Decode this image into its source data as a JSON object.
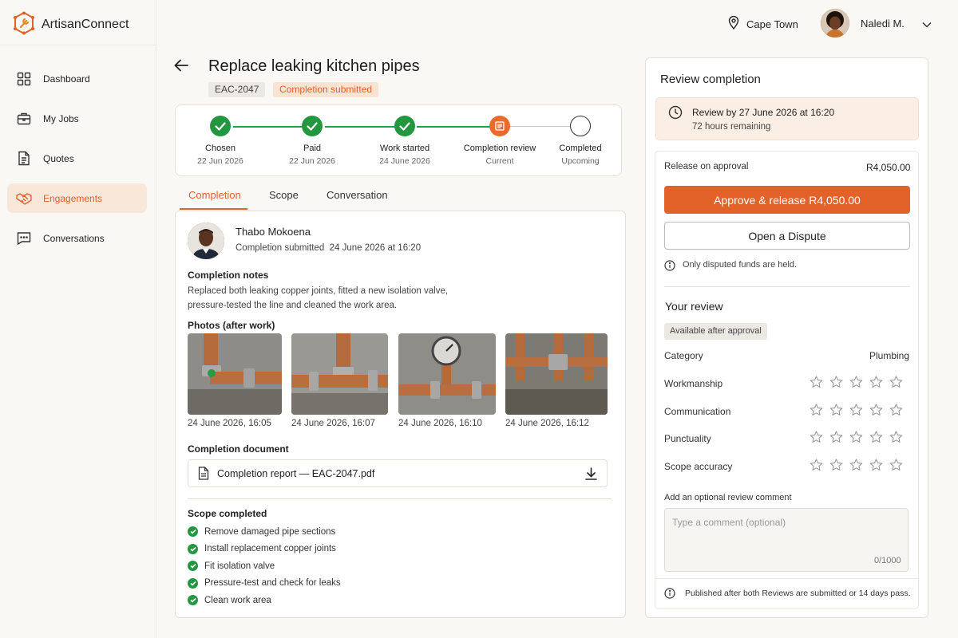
{
  "app": {
    "name": "ArtisanConnect"
  },
  "sidebar": {
    "items": [
      {
        "label": "Dashboard"
      },
      {
        "label": "My Jobs"
      },
      {
        "label": "Quotes"
      },
      {
        "label": "Engagements"
      },
      {
        "label": "Conversations"
      }
    ]
  },
  "header": {
    "location": "Cape Town",
    "user_name": "Naledi M."
  },
  "job": {
    "title": "Replace leaking kitchen pipes",
    "id": "EAC-2047",
    "status": "Completion submitted"
  },
  "stepper": {
    "steps": [
      {
        "label": "Chosen",
        "sub": "22 Jun 2026",
        "state": "done"
      },
      {
        "label": "Paid",
        "sub": "22 Jun 2026",
        "state": "done"
      },
      {
        "label": "Work started",
        "sub": "24 June 2026",
        "state": "done"
      },
      {
        "label": "Completion review",
        "sub": "Current",
        "state": "current"
      },
      {
        "label": "Completed",
        "sub": "Upcoming",
        "state": "upcoming"
      }
    ]
  },
  "tabs": [
    {
      "label": "Completion"
    },
    {
      "label": "Scope"
    },
    {
      "label": "Conversation"
    }
  ],
  "completion": {
    "artisan_name": "Thabo Mokoena",
    "submitted_label": "Completion submitted",
    "submitted_at": "24 June 2026 at 16:20",
    "notes_heading": "Completion notes",
    "notes_line1": "Replaced both leaking copper joints, fitted a new isolation valve,",
    "notes_line2": "pressure-tested the line and cleaned the work area.",
    "photos_heading": "Photos (after work)",
    "photos": [
      {
        "caption": "24 June 2026, 16:05"
      },
      {
        "caption": "24 June 2026, 16:07"
      },
      {
        "caption": "24 June 2026, 16:10"
      },
      {
        "caption": "24 June 2026, 16:12"
      }
    ],
    "document_heading": "Completion document",
    "document_name": "Completion report — EAC-2047.pdf",
    "scope_heading": "Scope completed",
    "scope_items": [
      "Remove damaged pipe sections",
      "Install replacement copper joints",
      "Fit isolation valve",
      "Pressure-test and check for leaks",
      "Clean work area"
    ]
  },
  "review_panel": {
    "title": "Review completion",
    "deadline": "Review by 27 June 2026 at 16:20",
    "remaining": "72 hours remaining",
    "release_label": "Release on approval",
    "release_amount": "R4,050.00",
    "approve_button": "Approve & release R4,050.00",
    "dispute_button": "Open a Dispute",
    "held_note": "Only disputed funds are held.",
    "your_review": "Your review",
    "available_badge": "Available after approval",
    "category_label": "Category",
    "category_value": "Plumbing",
    "ratings": [
      {
        "label": "Workmanship",
        "stars": 0
      },
      {
        "label": "Communication",
        "stars": 0
      },
      {
        "label": "Punctuality",
        "stars": 0
      },
      {
        "label": "Scope accuracy",
        "stars": 0
      }
    ],
    "comment_label": "Add an optional review comment",
    "comment_placeholder": "Type a comment (optional)",
    "comment_counter": "0/1000",
    "publish_note": "Published after both Reviews are submitted or 14 days pass."
  },
  "colors": {
    "accent": "#e2622a",
    "success": "#23973f",
    "accent_soft": "#f9e7da"
  }
}
